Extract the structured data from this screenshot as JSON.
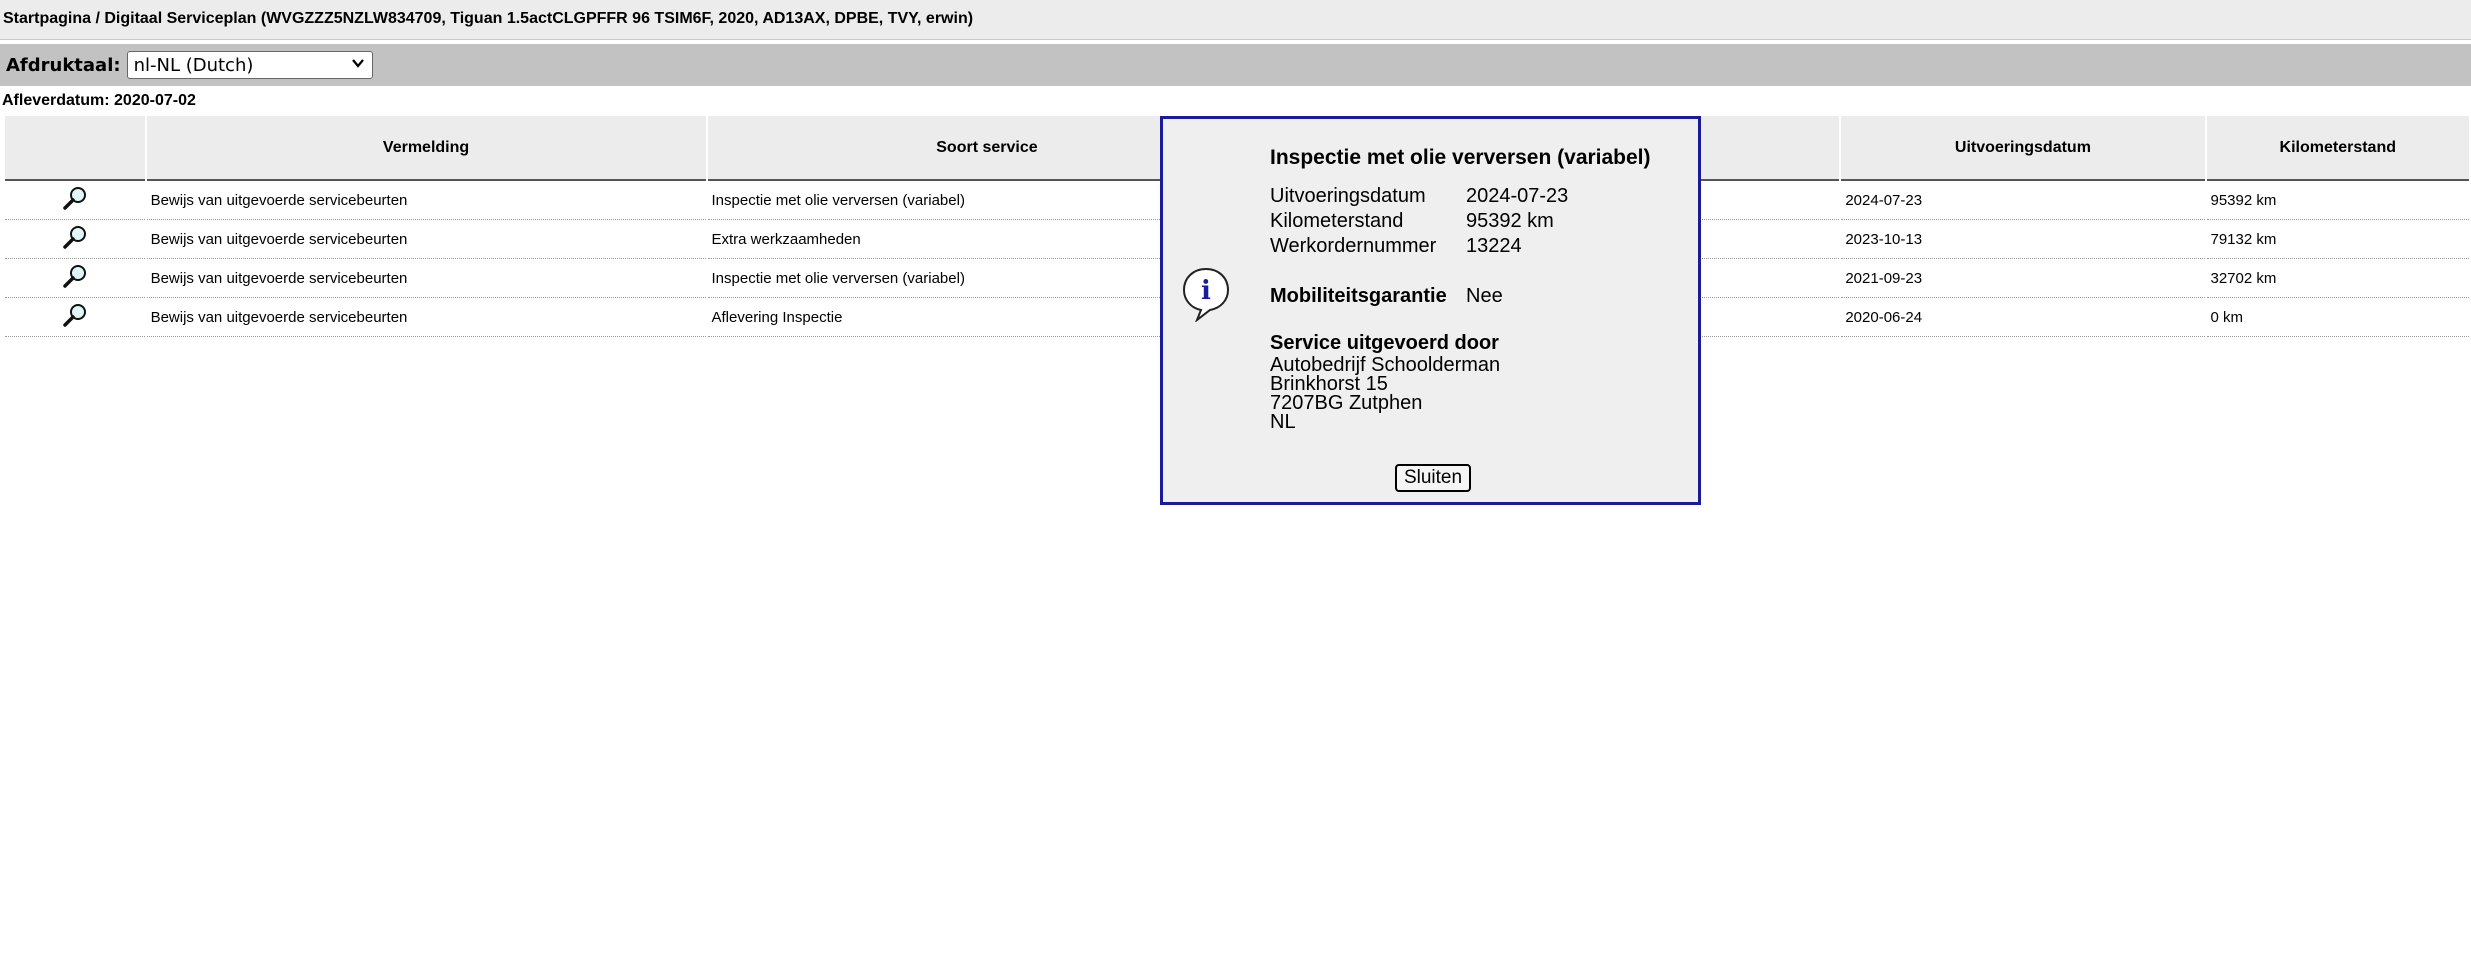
{
  "breadcrumb": "Startpagina / Digitaal Serviceplan (WVGZZZ5NZLW834709, Tiguan 1.5actCLGPFFR 96 TSIM6F, 2020, AD13AX, DPBE, TVY, erwin)",
  "language": {
    "label": "Afdruktaal:",
    "selected": "nl-NL (Dutch)"
  },
  "delivery_date": "Afleverdatum: 2020-07-02",
  "table": {
    "headers": [
      "Vermelding",
      "Soort service",
      "Uitvoeringsdatum",
      "Kilometerstand"
    ],
    "rows": [
      {
        "entry": "Bewijs van uitgevoerde servicebeurten",
        "service": "Inspectie met olie verversen (variabel)",
        "date": "2024-07-23",
        "km": "95392 km"
      },
      {
        "entry": "Bewijs van uitgevoerde servicebeurten",
        "service": "Extra werkzaamheden",
        "date": "2023-10-13",
        "km": "79132 km"
      },
      {
        "entry": "Bewijs van uitgevoerde servicebeurten",
        "service": "Inspectie met olie verversen (variabel)",
        "date": "2021-09-23",
        "km": "32702 km"
      },
      {
        "entry": "Bewijs van uitgevoerde servicebeurten",
        "service": "Aflevering Inspectie",
        "date": "2020-06-24",
        "km": "0 km"
      }
    ]
  },
  "dialog": {
    "title": "Inspectie met olie verversen (variabel)",
    "fields": [
      {
        "label": "Uitvoeringsdatum",
        "value": "2024-07-23"
      },
      {
        "label": "Kilometerstand",
        "value": "95392 km"
      },
      {
        "label": "Werkordernummer",
        "value": "13224"
      }
    ],
    "mobility": {
      "label": "Mobiliteitsgarantie",
      "value": "Nee"
    },
    "service_by": {
      "label": "Service uitgevoerd door",
      "lines": [
        "Autobedrijf Schoolderman",
        "Brinkhorst 15",
        "7207BG Zutphen",
        "NL"
      ]
    },
    "close_label": "Sluiten"
  },
  "icons": {
    "row_action": "magnifier-icon",
    "dialog": "info-icon",
    "select": "chevron-down-icon"
  },
  "colors": {
    "dialog_border": "#1a1a9a",
    "header_bg": "#ececec",
    "lang_bar_bg": "#c2c2c2"
  }
}
